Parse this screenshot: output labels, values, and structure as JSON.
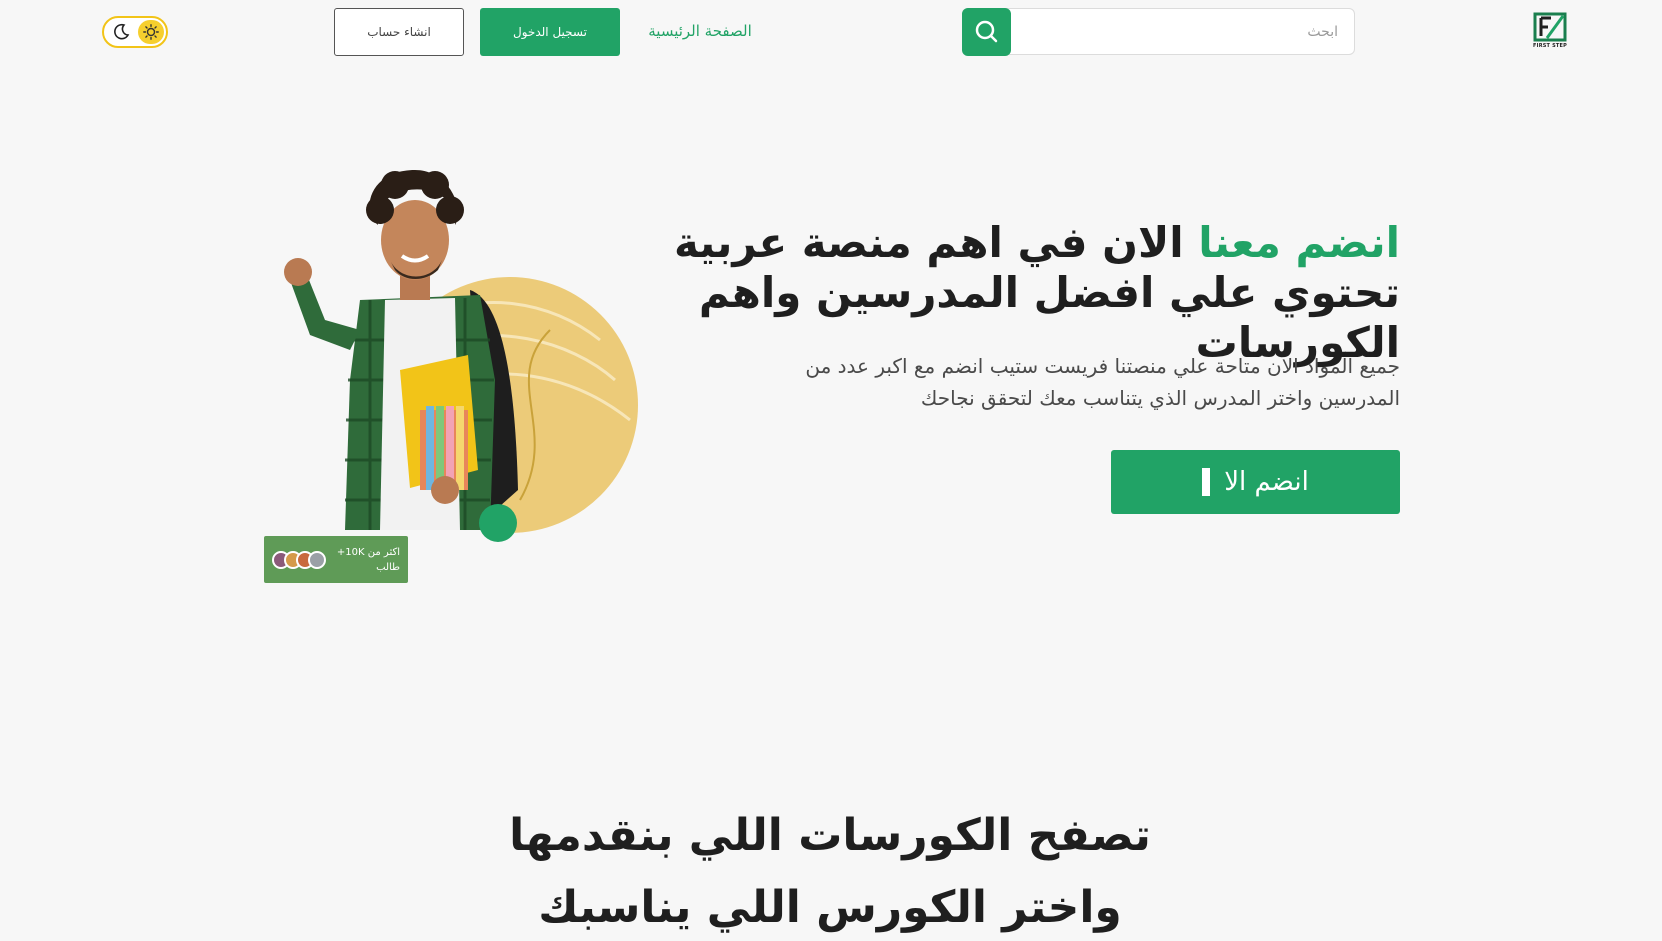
{
  "header": {
    "logo_text": "FIRST STEP",
    "search_placeholder": "ابحث",
    "nav_home": "الصفحة الرئيسية",
    "login_label": "تسجيل الدخول",
    "signup_label": "انشاء حساب"
  },
  "hero": {
    "title_accent": "انضم معنا",
    "title_rest": "الان في اهم منصة عربية تحتوي علي افضل المدرسين واهم الكورسات",
    "description": "جميع المواد الان متاحة علي منصتنا فريست ستيب انضم مع اكبر عدد من المدرسين واختر المدرس الذي يتناسب معك لتحقق نجاحك",
    "cta_label": "انضم الا"
  },
  "students_badge": {
    "line1": "اكثر من 10K+",
    "line2": "طالب"
  },
  "courses_section": {
    "title": "تصفح الكورسات اللي بنقدمها واختر الكورس اللي يناسبك"
  },
  "colors": {
    "accent": "#21a366",
    "sun": "#f6cf2e",
    "badge": "#5f9b57",
    "circle_decor": "#eccb79"
  },
  "icons": [
    "logo-icon",
    "search-icon",
    "moon-icon",
    "sun-icon"
  ]
}
